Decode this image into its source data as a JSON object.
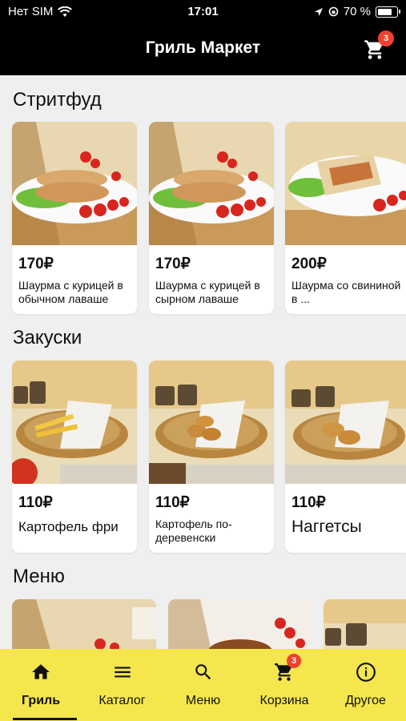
{
  "status_bar": {
    "carrier": "Нет SIM",
    "time": "17:01",
    "battery": "70 %",
    "battery_level": 0.7
  },
  "header": {
    "title": "Гриль Маркет",
    "cart_count": "3"
  },
  "sections": [
    {
      "title": "Стритфуд",
      "items": [
        {
          "price": "170₽",
          "name": "Шаурма с курицей в обычном лаваше"
        },
        {
          "price": "170₽",
          "name": "Шаурма с курицей в сырном лаваше"
        },
        {
          "price": "200₽",
          "name": "Шаурма со свининой в ..."
        }
      ]
    },
    {
      "title": "Закуски",
      "items": [
        {
          "price": "110₽",
          "name": "Картофель фри"
        },
        {
          "price": "110₽",
          "name": "Картофель по-деревенски"
        },
        {
          "price": "110₽",
          "name": "Наггетсы"
        }
      ]
    },
    {
      "title": "Меню"
    }
  ],
  "tabbar": {
    "tabs": [
      {
        "label": "Гриль",
        "icon": "home-icon",
        "active": true
      },
      {
        "label": "Каталог",
        "icon": "menu-icon"
      },
      {
        "label": "Меню",
        "icon": "search-icon"
      },
      {
        "label": "Корзина",
        "icon": "cart-icon",
        "badge": "3"
      },
      {
        "label": "Другое",
        "icon": "info-icon"
      }
    ]
  },
  "colors": {
    "accent": "#f5e64e",
    "badge": "#f0412f",
    "header": "#000000"
  }
}
